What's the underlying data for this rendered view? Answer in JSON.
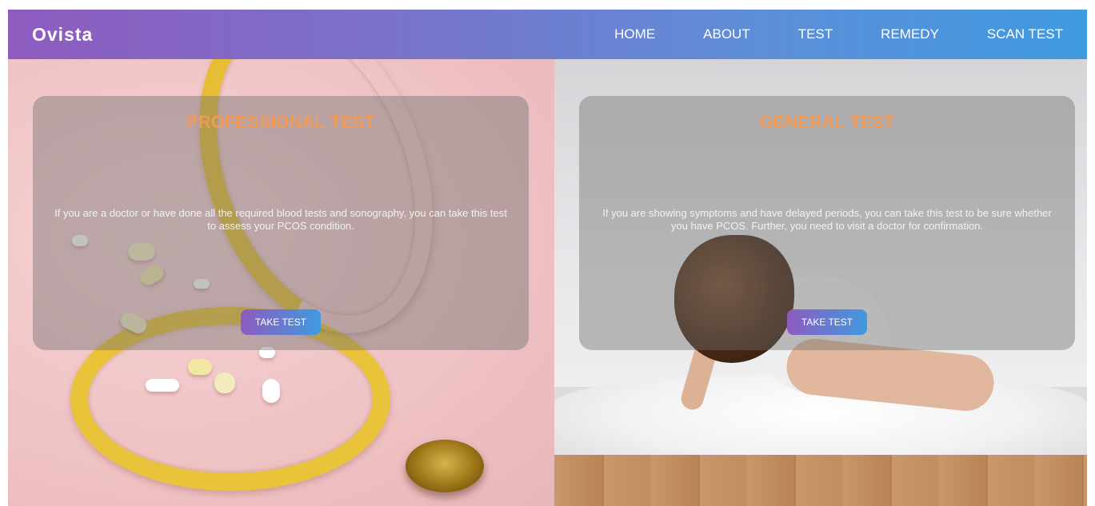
{
  "navbar": {
    "brand": "Ovista",
    "links": [
      "HOME",
      "ABOUT",
      "TEST",
      "REMEDY",
      "SCAN TEST"
    ],
    "gradient": [
      "#8e5bbf",
      "#3f9ae0"
    ]
  },
  "cards": [
    {
      "title": "PROFESSIONAL TEST",
      "description": "If you are a doctor or have done all the required blood tests and sonography, you can take this test to assess your PCOS condition.",
      "button": "TAKE TEST",
      "background_image": "stethoscope-and-pills"
    },
    {
      "title": "GENERAL TEST",
      "description": "If you are showing symptoms and have delayed periods, you can take this test to be sure whether you have PCOS. Further, you need to visit a doctor for confirmation.",
      "button": "TAKE TEST",
      "background_image": "woman-sitting-on-rug"
    }
  ],
  "colors": {
    "title_accent": "#f29a54",
    "card_overlay": "rgba(110,110,110,0.42)"
  }
}
